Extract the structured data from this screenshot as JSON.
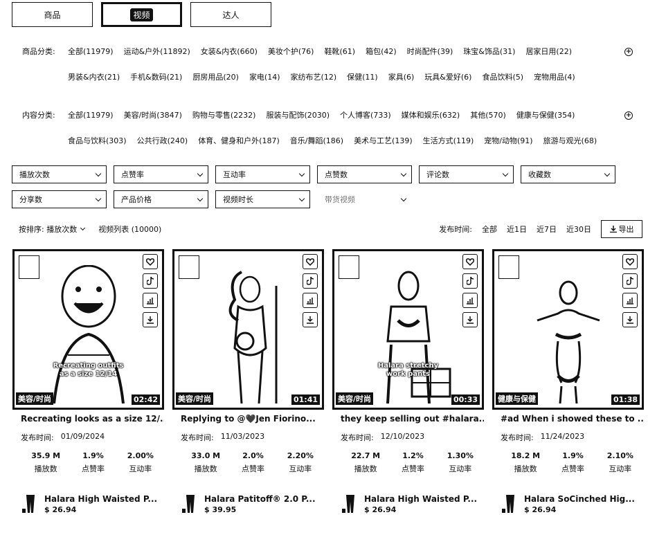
{
  "tabs": [
    "商品",
    "视频",
    "达人"
  ],
  "product_categories": {
    "label": "商品分类:",
    "row1": [
      "全部(11979)",
      "运动&户外(11892)",
      "女装&内衣(660)",
      "美妆个护(76)",
      "鞋靴(61)",
      "箱包(42)",
      "时尚配件(39)",
      "珠宝&饰品(31)",
      "居家日用(22)"
    ],
    "row2": [
      "男装&内衣(21)",
      "手机&数码(21)",
      "厨房用品(20)",
      "家电(14)",
      "家纺布艺(12)",
      "保健(11)",
      "家具(6)",
      "玩具&爱好(6)",
      "食品饮料(5)",
      "宠物用品(4)"
    ]
  },
  "content_categories": {
    "label": "内容分类:",
    "row1": [
      "全部(11979)",
      "美容/时尚(3847)",
      "购物与零售(2232)",
      "服装与配饰(2030)",
      "个人博客(733)",
      "媒体和娱乐(632)",
      "其他(570)",
      "健康与保健(354)"
    ],
    "row2": [
      "食品与饮料(303)",
      "公共行政(240)",
      "体育、健身和户外(187)",
      "音乐/舞蹈(186)",
      "美术与工艺(139)",
      "生活方式(119)",
      "宠物/动物(91)",
      "旅游与观光(68)"
    ]
  },
  "plus_icon": "+",
  "dropdowns": {
    "row1": [
      "播放次数",
      "点赞率",
      "互动率",
      "点赞数",
      "评论数",
      "收藏数"
    ],
    "row2": [
      "分享数",
      "产品价格",
      "视频时长"
    ],
    "plain": "带货视频"
  },
  "toolbar": {
    "sort_label": "按排序: 播放次数",
    "count": "视频列表 (10000)",
    "publish_label": "发布时间:",
    "ranges": [
      "全部",
      "近1日",
      "近7日",
      "近30日"
    ],
    "export": "导出"
  },
  "cards": [
    {
      "caption": "Recreating outfits\nas a size 12/14",
      "category": "美容/时尚",
      "duration": "02:42",
      "title": "Recreating looks as a size 12/...",
      "pub_label": "发布时间:",
      "pub_date": "01/09/2024",
      "stats": [
        {
          "v": "35.9 M",
          "l": "播放数"
        },
        {
          "v": "1.9%",
          "l": "点赞率"
        },
        {
          "v": "2.00%",
          "l": "互动率"
        }
      ],
      "product_name": "Halara High Waisted P...",
      "product_price": "$ 26.94"
    },
    {
      "caption": "",
      "category": "美容/时尚",
      "duration": "01:41",
      "title": "Replying to @🖤Jen Fiorino...",
      "pub_label": "发布时间:",
      "pub_date": "11/03/2023",
      "stats": [
        {
          "v": "33.0 M",
          "l": "播放数"
        },
        {
          "v": "2.0%",
          "l": "点赞率"
        },
        {
          "v": "2.20%",
          "l": "互动率"
        }
      ],
      "product_name": "Halara Patitoff® 2.0 P...",
      "product_price": "$ 39.95"
    },
    {
      "caption": "Halara stretchy\nwork pants",
      "category": "美容/时尚",
      "duration": "00:33",
      "title": "they keep selling out #halara...",
      "pub_label": "发布时间:",
      "pub_date": "12/10/2023",
      "stats": [
        {
          "v": "22.7 M",
          "l": "播放数"
        },
        {
          "v": "1.2%",
          "l": "点赞率"
        },
        {
          "v": "1.30%",
          "l": "互动率"
        }
      ],
      "product_name": "Halara High Waisted P...",
      "product_price": "$ 26.94"
    },
    {
      "caption": "",
      "category": "健康与保健",
      "duration": "01:38",
      "title": "#ad When i showed these to ...",
      "pub_label": "发布时间:",
      "pub_date": "11/24/2023",
      "stats": [
        {
          "v": "18.2 M",
          "l": "播放数"
        },
        {
          "v": "1.9%",
          "l": "点赞率"
        },
        {
          "v": "2.10%",
          "l": "互动率"
        }
      ],
      "product_name": "Halara SoCinched Hig...",
      "product_price": "$ 26.94"
    }
  ],
  "icons": {
    "side": [
      "heart-icon",
      "tiktok-icon",
      "chart-icon",
      "download-icon"
    ],
    "export": "download-icon"
  }
}
